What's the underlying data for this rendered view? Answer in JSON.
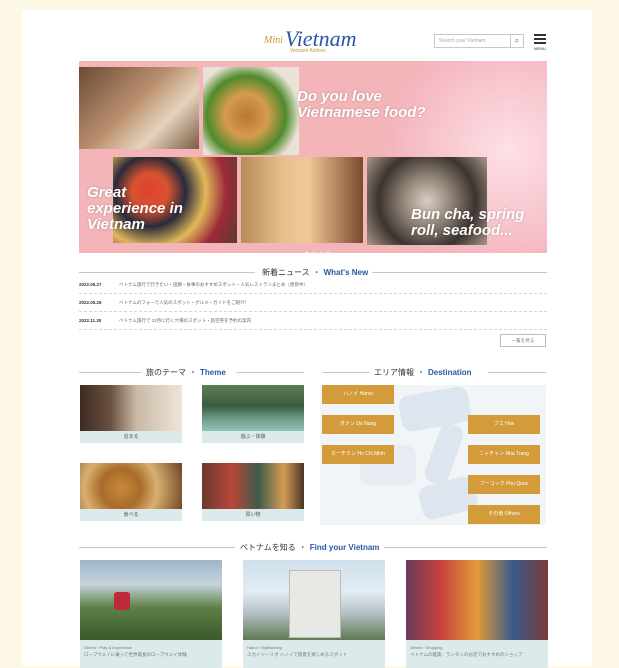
{
  "header": {
    "logo_prefix": "Mini",
    "logo_text": "Vietnam",
    "logo_sub": "Vietnam Airlines",
    "search_placeholder": "Search your Vietnam",
    "search_icon_label": "⌕",
    "menu_label": "MENU"
  },
  "hero": {
    "caption_1": "Do you love Vietnamese food?",
    "caption_2": "Great experience in Vietnam",
    "caption_3": "Bun cha, spring roll, seafood..."
  },
  "news": {
    "title_jp": "新着ニュース",
    "sep": "・",
    "title_en": "What's New",
    "items": [
      {
        "date": "2022.05.27",
        "text": "ベトナム旅行で行きたい・話題・食事のおすすめスポット・人気レストランまとめ（更新中）"
      },
      {
        "date": "2022.05.26",
        "text": "ベトナムのフォーで人気のスポット・グルメ・ガイドをご紹介！"
      },
      {
        "date": "2022.11.30",
        "text": "ベトナム旅行で 12月に行く穴場のスポット・航空券を予約の案内"
      }
    ],
    "list_button": "一覧を見る"
  },
  "theme": {
    "title_jp": "旅のテーマ",
    "sep": "・",
    "title_en": "Theme",
    "items": [
      {
        "label": "泊まる"
      },
      {
        "label": "遊ぶ・体験"
      },
      {
        "label": "食べる"
      },
      {
        "label": "買い物"
      }
    ]
  },
  "destination": {
    "title_jp": "エリア情報",
    "sep": "・",
    "title_en": "Destination",
    "buttons": [
      {
        "label": "ハノイ  Hanoi"
      },
      {
        "label": "ダナン  Da Nang"
      },
      {
        "label": "ホーチミン  Ho Chi Minh"
      },
      {
        "label": "フエ  Hue"
      },
      {
        "label": "ニャチャン  Nha Trang"
      },
      {
        "label": "フーコック  Phu Quoc"
      },
      {
        "label": "その他  Others"
      }
    ]
  },
  "find": {
    "title_jp": "ベトナムを知る",
    "sep": "・",
    "title_en": "Find your Vietnam",
    "cards": [
      {
        "tag": "Others › Play & Experience",
        "text": "ロープウェイに乗って世界最長のロープウェイ体験"
      },
      {
        "tag": "Hanoi › Sightseeing",
        "text": "スカイツーリボ ハノイで夜景を楽しめるスポット"
      },
      {
        "tag": "Others › Shopping",
        "text": "ベトナムの雑貨、ランタンのお店でおすすめのショップ"
      }
    ]
  }
}
